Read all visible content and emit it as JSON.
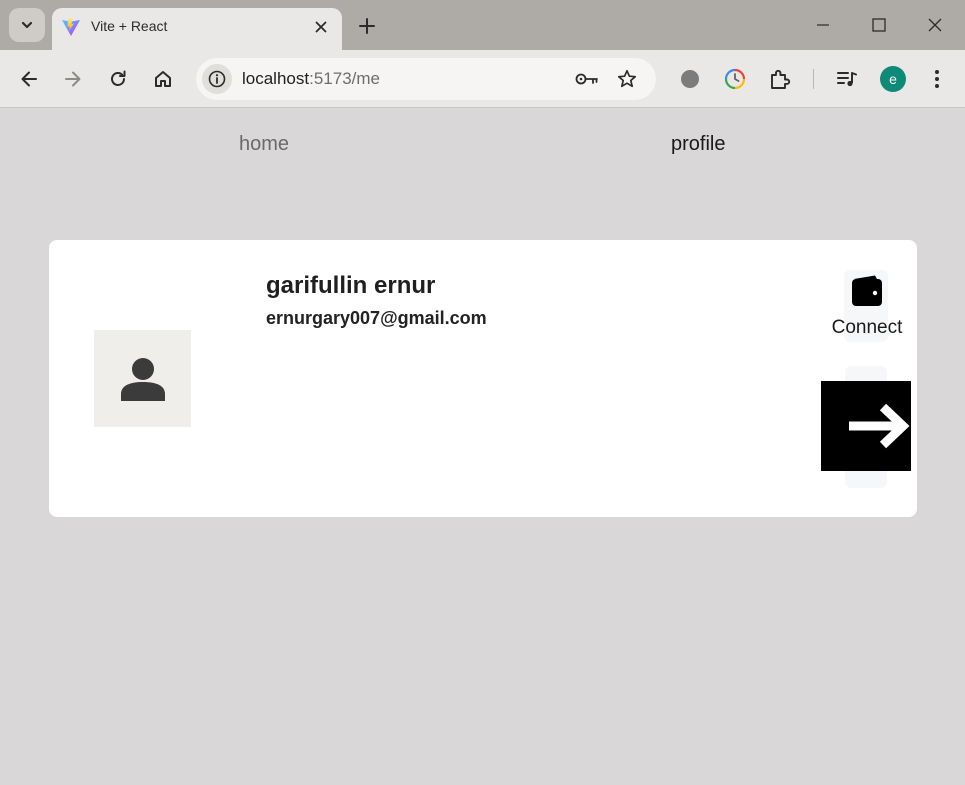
{
  "browser": {
    "tab": {
      "title": "Vite + React",
      "favicon": "vite-logo"
    },
    "address_bar": {
      "host": "localhost",
      "path": ":5173/me"
    },
    "profile_initial": "e",
    "icons": [
      "tab-search-icon",
      "close-icon",
      "plus-icon",
      "minimize-icon",
      "maximize-icon",
      "close-window-icon",
      "back-arrow-icon",
      "forward-arrow-icon",
      "reload-icon",
      "home-icon",
      "info-icon",
      "key-icon",
      "star-icon",
      "extension-dot-icon",
      "clock-icon",
      "puzzle-icon",
      "media-icon",
      "menu-dots-icon"
    ]
  },
  "nav": {
    "home": "home",
    "profile": "profile"
  },
  "profile": {
    "name": "garifullin ernur",
    "email": "ernurgary007@gmail.com",
    "connect_label": "Connect",
    "icons": [
      "user-icon",
      "wallet-icon",
      "arrow-right-icon"
    ]
  },
  "colors": {
    "page_bg": "#d9d7d8",
    "card_bg": "#ffffff",
    "tabstrip_bg": "#aeaba6",
    "toolbar_bg": "#e9e8e6",
    "avatar_chip": "#0f8a78",
    "logout_bg": "#000000"
  }
}
